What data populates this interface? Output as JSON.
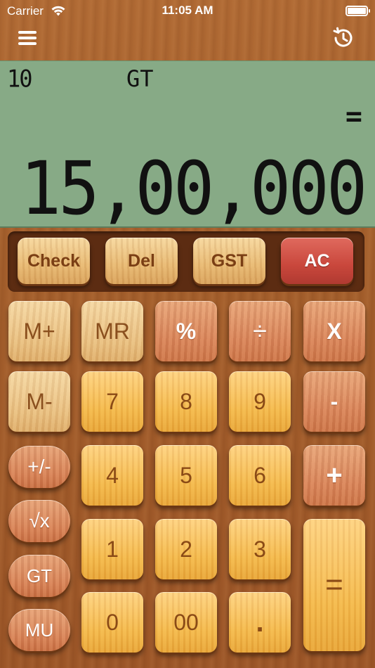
{
  "status_bar": {
    "carrier": "Carrier",
    "time": "11:05 AM"
  },
  "topbar": {
    "menu_icon": "menu-icon",
    "history_icon": "history-icon"
  },
  "display": {
    "count": "10",
    "gt_indicator": "GT",
    "operator": "=",
    "value": "15,00,000"
  },
  "function_keys": [
    {
      "id": "check",
      "label": "Check"
    },
    {
      "id": "del",
      "label": "Del"
    },
    {
      "id": "gst",
      "label": "GST"
    },
    {
      "id": "ac",
      "label": "AC"
    }
  ],
  "keys": {
    "m_plus": "M+",
    "mr": "MR",
    "percent": "%",
    "divide": "÷",
    "multiply": "X",
    "m_minus": "M-",
    "seven": "7",
    "eight": "8",
    "nine": "9",
    "minus": "-",
    "plus_minus": "+/-",
    "four": "4",
    "five": "5",
    "six": "6",
    "plus": "+",
    "sqrt": "√x",
    "one": "1",
    "two": "2",
    "three": "3",
    "equals": "=",
    "gt": "GT",
    "mu": "MU",
    "zero": "0",
    "double_zero": "00",
    "dot": "."
  },
  "colors": {
    "lcd": "#87aa86",
    "ac": "#c9473c",
    "gold_key": "#f4b84a",
    "orange_key": "#d9845a"
  }
}
